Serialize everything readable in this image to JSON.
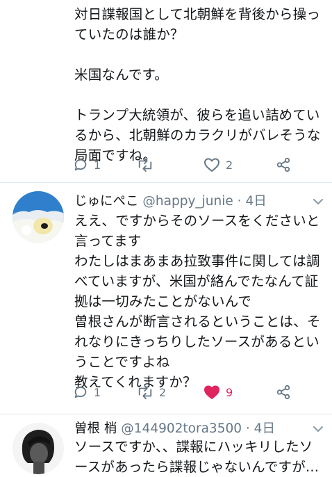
{
  "tweet1": {
    "text": "対日諜報国として北朝鮮を背後から操っていたのは誰か？\n\n米国なんです。\n\nトランプ大統領が、彼らを追い詰めているから、北朝鮮のカラクリがバレそうな局面ですね。",
    "reply_count": "1",
    "retweet_count": "",
    "like_count": "2"
  },
  "tweet2": {
    "display_name": "じゅにぺこ",
    "handle": "@happy_junie",
    "separator": "·",
    "time": "4日",
    "text": "ええ、ですからそのソースをくださいと言ってます\nわたしはまあまあ拉致事件に関しては調べていますが、米国が絡んでたなんて証拠は一切みたことがないんで\n曽根さんが断言されるということは、それなりにきっちりしたソースがあるということですよね\n教えてくれますか？",
    "reply_count": "1",
    "retweet_count": "2",
    "like_count": "9"
  },
  "tweet3": {
    "display_name": "曽根 梢",
    "handle": "@144902tora3500",
    "separator": "·",
    "time": "4日",
    "text": "ソースですか、、諜報にハッキリしたソースがあったら諜報じゃないんですが..."
  },
  "icons": {
    "reply": "reply-icon",
    "retweet": "retweet-icon",
    "like": "heart-icon",
    "share": "share-icon",
    "more": "chevron-down-icon"
  },
  "colors": {
    "text": "#14171a",
    "muted": "#657786",
    "like_active": "#e0245e",
    "divider": "#e1e8ed"
  }
}
